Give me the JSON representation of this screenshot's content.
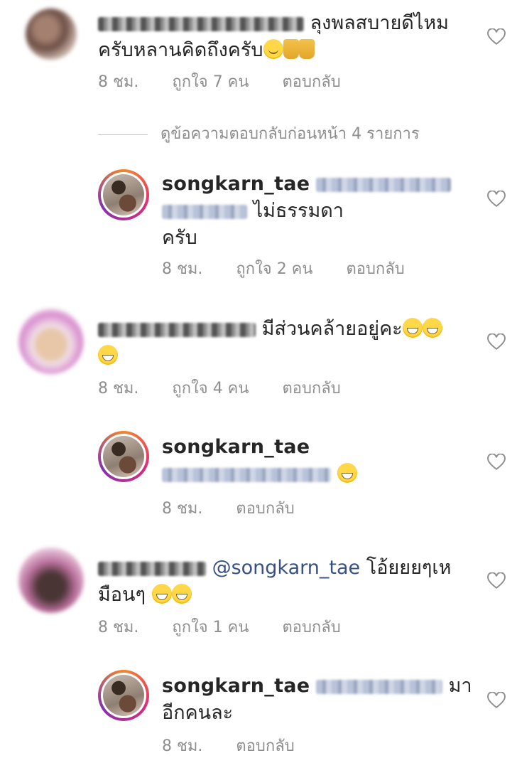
{
  "comments": [
    {
      "text": "ลุงพลสบายดีไหม",
      "text2": "ครับหลานคิดถึงครับ",
      "time": "8 ชม.",
      "likes": "ถูกใจ 7 คน",
      "reply": "ตอบกลับ"
    },
    {
      "view_replies": "ดูข้อความตอบกลับก่อนหน้า 4 รายการ"
    },
    {
      "username": "songkarn_tae",
      "text": "ไม่ธรรมดา",
      "text2": "ครับ",
      "time": "8 ชม.",
      "likes": "ถูกใจ 2 คน",
      "reply": "ตอบกลับ"
    },
    {
      "text": "มีส่วนคล้ายอยู่คะ",
      "time": "8 ชม.",
      "likes": "ถูกใจ 4 คน",
      "reply": "ตอบกลับ"
    },
    {
      "username": "songkarn_tae",
      "time": "8 ชม.",
      "reply": "ตอบกลับ"
    },
    {
      "mention": "@songkarn_tae",
      "text": "โอ้ยยยๆเห",
      "text2": "มือนๆ",
      "time": "8 ชม.",
      "likes": "ถูกใจ 1 คน",
      "reply": "ตอบกลับ"
    },
    {
      "username": "songkarn_tae",
      "text": "มา",
      "text2": "อีกคนละ",
      "time": "8 ชม.",
      "reply": "ตอบกลับ"
    }
  ],
  "icons": {
    "like": "heart-outline-icon"
  }
}
